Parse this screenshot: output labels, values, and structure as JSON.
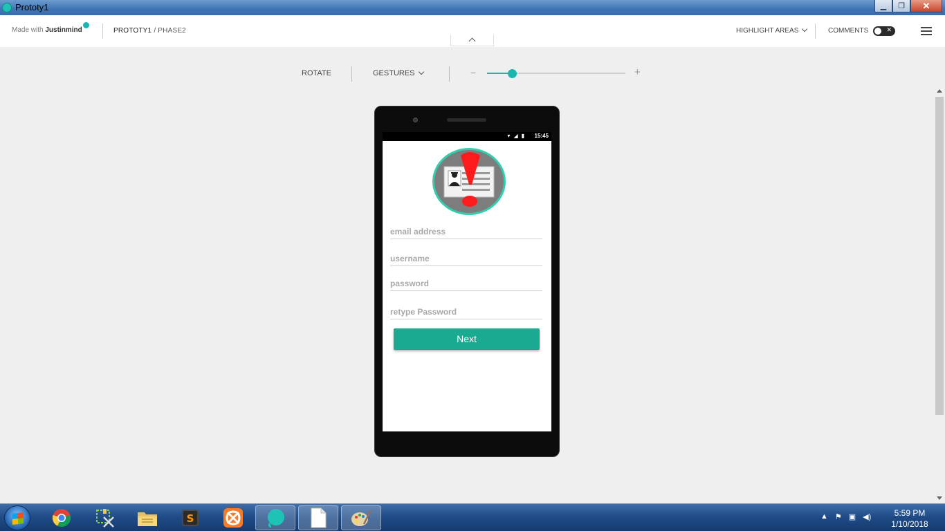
{
  "window": {
    "title": "Prototy1"
  },
  "header": {
    "made_with_prefix": "Made with",
    "made_with_brand": "Justinmind",
    "project": "PROTOTY1",
    "separator": "/",
    "page": "PHASE2",
    "highlight_label": "HIGHLIGHT AREAS",
    "comments_label": "COMMENTS"
  },
  "toolbar": {
    "rotate_label": "ROTATE",
    "gestures_label": "GESTURES",
    "zoom_minus": "−",
    "zoom_plus": "+",
    "zoom_level": 0.18
  },
  "device": {
    "status_time": "15:45"
  },
  "form": {
    "email_placeholder": "email address",
    "username_placeholder": "username",
    "password_placeholder": "password",
    "retype_placeholder": "retype Password",
    "next_label": "Next"
  },
  "taskbar": {
    "apps": [
      "chrome-icon",
      "snipping-tool-icon",
      "file-explorer-icon",
      "sublime-text-icon",
      "xampp-icon",
      "justinmind-icon",
      "document-icon",
      "paint-icon"
    ],
    "clock_time": "5:59 PM",
    "clock_date": "1/10/2018"
  },
  "colors": {
    "accent": "#1ab7b1",
    "button": "#1aaa92",
    "logo_ring": "#2fd0ae",
    "alert": "#ff1b1b"
  }
}
